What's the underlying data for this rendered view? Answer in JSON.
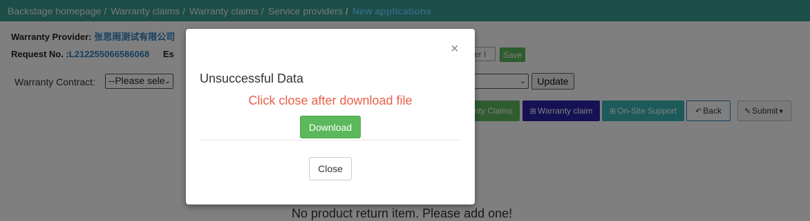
{
  "breadcrumb": {
    "items": [
      "Backstage homepage",
      "Warranty claims",
      "Warranty claims",
      "Service providers"
    ],
    "active": "New applications",
    "separator": "/"
  },
  "info": {
    "provider_label": "Warranty Provider:",
    "provider_value": "张思雨测试有限公司",
    "request_label": "Request No. :",
    "request_value": "L212255066586068",
    "est_partial": "Es"
  },
  "customer_input": {
    "placeholder": "mer I"
  },
  "save_label": "Save",
  "contract": {
    "label": "Warranty Contract:",
    "select_value": "--Please sele",
    "second_select_value": ""
  },
  "update_label": "Update",
  "actions": {
    "claims_label": "nty Claims",
    "warranty_claim_label": "Warranty claim",
    "onsite_label": "On-Site Support",
    "back_label": "Back",
    "submit_label": "Submit"
  },
  "empty_message": "No product return item. Please add one!",
  "modal": {
    "title": "Unsuccessful Data",
    "message": "Click close after download file",
    "download_label": "Download",
    "close_label": "Close",
    "close_icon": "×"
  },
  "colors": {
    "header": "#3a9b8f",
    "active_crumb": "#5fd2ff",
    "success": "#5cb85c",
    "warning_text": "#e8604c",
    "warranty_btn": "#2b22a8",
    "onsite_btn": "#3ab5b5"
  }
}
